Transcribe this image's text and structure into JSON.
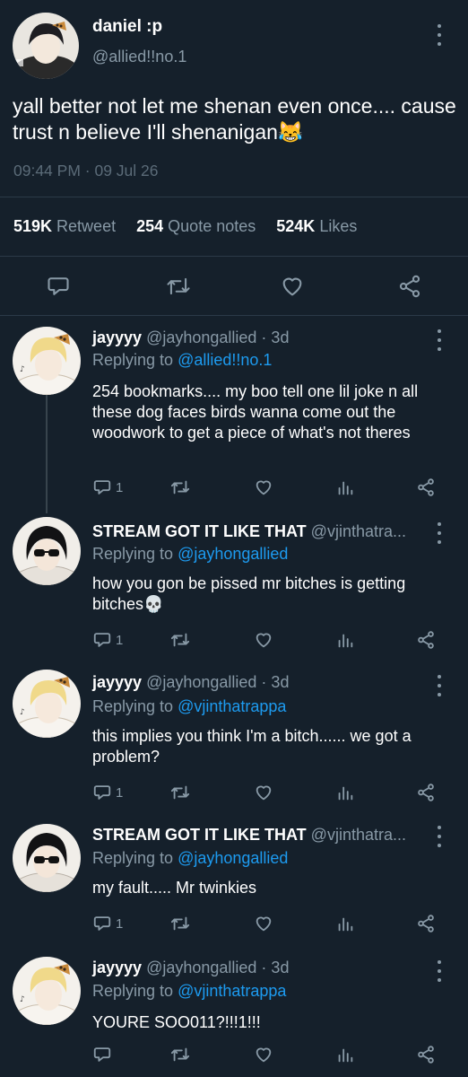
{
  "main_tweet": {
    "display_name": "daniel :p",
    "handle": "@allied!!no.1",
    "text": "yall better not let me shenan even once.... cause trust n believe I'll shenanigan",
    "emoji": "😹",
    "timestamp": "09:44 PM · 09 Jul 26",
    "stats": {
      "retweets_count": "519K",
      "retweets_label": "Retweet",
      "quotes_count": "254",
      "quotes_label": "Quote notes",
      "likes_count": "524K",
      "likes_label": "Likes"
    }
  },
  "replies": [
    {
      "display_name": "jayyyy",
      "meta": "@jayhongallied · 3d",
      "replying_prefix": "Replying to",
      "replying_to": "@allied!!no.1",
      "text": "254 bookmarks.... my boo tell one lil joke n all these dog faces birds wanna come out the woodwork to get a piece of what's not theres",
      "reply_count": "1"
    },
    {
      "display_name": "STREAM GOT IT LIKE THAT",
      "meta": "@vjinthatra...",
      "replying_prefix": "Replying to",
      "replying_to": "@jayhongallied",
      "text": "how you gon be pissed mr bitches is getting bitches",
      "emoji": "💀",
      "reply_count": "1"
    },
    {
      "display_name": "jayyyy",
      "meta": "@jayhongallied · 3d",
      "replying_prefix": "Replying to",
      "replying_to": "@vjinthatrappa",
      "text": "this implies you think I'm a bitch...... we got a problem?",
      "reply_count": "1"
    },
    {
      "display_name": "STREAM GOT IT LIKE THAT",
      "meta": "@vjinthatra...",
      "replying_prefix": "Replying to",
      "replying_to": "@jayhongallied",
      "text": "my fault..... Mr twinkies",
      "reply_count": "1"
    },
    {
      "display_name": "jayyyy",
      "meta": "@jayhongallied · 3d",
      "replying_prefix": "Replying to",
      "replying_to": "@vjinthatrappa",
      "text": "YOURE SOO011?!!!1!!!",
      "reply_count": ""
    }
  ],
  "icons": {
    "reply": "reply-icon",
    "retweet": "retweet-icon",
    "like": "heart-icon",
    "analytics": "analytics-icon",
    "share": "share-icon",
    "menu": "more-vertical-icon"
  },
  "colors": {
    "background": "#15202b",
    "secondary_text": "#8899a6",
    "mention": "#1d9bf0",
    "divider": "#2b3a48"
  }
}
